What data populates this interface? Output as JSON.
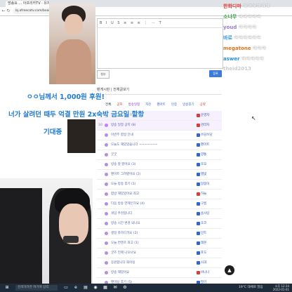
{
  "browser": {
    "tab_title": "방송요 ... 아프리카TV · 유저",
    "url": "bj.afreecatv.com/board/write",
    "back_icon": "arrow-left-icon",
    "forward_icon": "arrow-right-icon",
    "refresh_icon": "refresh-icon"
  },
  "editor": {
    "toolbar_text": "B I U S ≡ ≡ ≡ ⋮ ⋯ T",
    "attach_label": "첨부",
    "submit_label": "등록"
  },
  "board": {
    "title": "팬게시판 | 전체글보기",
    "filters": [
      "전체",
      "공지",
      "방송일정",
      "자유",
      "팬아트",
      "인증",
      "방송후기",
      "공략"
    ],
    "filter_colors": [
      "#333333",
      "#c03030",
      "#8040c0",
      "#3366cc",
      "#3366cc",
      "#3366cc",
      "#3366cc",
      "#d04040"
    ],
    "rows": [
      {
        "num": "",
        "title": "[공지] 게시판 이용 안내",
        "user": "운영자",
        "highlight": true,
        "ticon": "#c080ff",
        "uicon": "#d04040"
      },
      {
        "num": "10",
        "title": "방송 일정 공지 (8)",
        "user": "관리자",
        "highlight": true,
        "ticon": "#c080ff",
        "uicon": "#d04040"
      },
      {
        "num": "",
        "title": "이번주 합방 안내",
        "user": "쓰담쓰담",
        "highlight": false,
        "ticon": "#b090e0",
        "uicon": "#3366cc"
      },
      {
        "num": "",
        "title": "오늘도 재밌었습니다 ~~~~~~~",
        "user": "팬아트",
        "highlight": false,
        "ticon": "#b090e0",
        "uicon": "#3366cc"
      },
      {
        "num": "",
        "title": "굿굿",
        "user": "깡통",
        "highlight": false,
        "ticon": "#b090e0",
        "uicon": "#3366cc"
      },
      {
        "num": "",
        "title": "방송 잘 봤어요 (3)",
        "user": "쪼꼬",
        "highlight": false,
        "ticon": "#b090e0",
        "uicon": "#3366cc"
      },
      {
        "num": "",
        "title": "팬아트 그려봤어요 (2)",
        "user": "별빛",
        "highlight": false,
        "ticon": "#b090e0",
        "uicon": "#3366cc"
      },
      {
        "num": "",
        "title": "오늘 방송 후기 (1)",
        "user": "달콤이",
        "highlight": false,
        "ticon": "#b090e0",
        "uicon": "#3366cc"
      },
      {
        "num": "",
        "title": "합방 재밌었어요 최고",
        "user": "하늘",
        "highlight": false,
        "ticon": "#b090e0",
        "uicon": "#d04040"
      },
      {
        "num": "",
        "title": "다음 방송 언제인가요 (4)",
        "user": "구름",
        "highlight": false,
        "ticon": "#b090e0",
        "uicon": "#3366cc"
      },
      {
        "num": "",
        "title": "게임 추천합니다",
        "user": "솜사탕",
        "highlight": false,
        "ticon": "#b090e0",
        "uicon": "#3366cc"
      },
      {
        "num": "",
        "title": "방송 시간 변경 되나요",
        "user": "초코",
        "highlight": false,
        "ticon": "#b090e0",
        "uicon": "#3366cc"
      },
      {
        "num": "",
        "title": "생일 축하드려요 (2)",
        "user": "민트",
        "highlight": false,
        "ticon": "#b090e0",
        "uicon": "#3366cc"
      },
      {
        "num": "",
        "title": "오늘 컨텐츠 최고 (1)",
        "user": "레몬",
        "highlight": false,
        "ticon": "#b090e0",
        "uicon": "#3366cc"
      },
      {
        "num": "",
        "title": "굿즈 언제 나오나요",
        "user": "포도",
        "highlight": false,
        "ticon": "#b090e0",
        "uicon": "#3366cc"
      },
      {
        "num": "",
        "title": "응원합니다 화이팅",
        "user": "사과",
        "highlight": false,
        "ticon": "#b090e0",
        "uicon": "#3366cc"
      },
      {
        "num": "",
        "title": "방송 재밌어요",
        "user": "바나나",
        "highlight": false,
        "ticon": "#b090e0",
        "uicon": "#d04040"
      },
      {
        "num": "",
        "title": "팬미팅 후기 (5)",
        "user": "딸기",
        "highlight": false,
        "ticon": "#b090e0",
        "uicon": "#3366cc"
      }
    ]
  },
  "overlay": {
    "line1": "ㅇㅇ님께서 1,000원 후원!",
    "line2": "너가 살려던 때두 억결 만원 2x숙박 금요일 할항",
    "line3": "기대중"
  },
  "chat": [
    {
      "name": "한화디마",
      "msg": "ㅋㅋㅋㅋㅋㅋ",
      "color": "#e03a3a"
    },
    {
      "name": "소나무",
      "msg": "ㅋㅋㅋㅋㅋ",
      "color": "#2e9e3a"
    },
    {
      "name": "youd",
      "msg": "ㅋㅋㅋㅋ",
      "color": "#9a7ad6"
    },
    {
      "name": "바로",
      "msg": "ㅋㅋㅋㅋㅋㅋ",
      "color": "#2a8fd8"
    },
    {
      "name": "megatone",
      "msg": "ㅋㅋㅋ",
      "color": "#e0731a"
    },
    {
      "name": "aswer",
      "msg": "ㅋㅋㅋㅋㅋ",
      "color": "#2a8fd8"
    },
    {
      "name": "theid2013",
      "msg": "",
      "color": "#cccccc"
    }
  ],
  "taskbar": {
    "search_placeholder": "검색하려면 여기에 입력",
    "weather": "19°C 대체로 맑음",
    "time": "오후 12:34",
    "date": "2022-01-01",
    "windows_icon": "windows-icon",
    "app_icons": [
      "task-view-icon",
      "edge-icon",
      "folder-icon",
      "chrome-icon",
      "store-icon",
      "mail-icon",
      "settings-icon"
    ]
  },
  "scroll_top_icon": "arrow-up-icon",
  "cursor_icon": "mouse-pointer-icon"
}
